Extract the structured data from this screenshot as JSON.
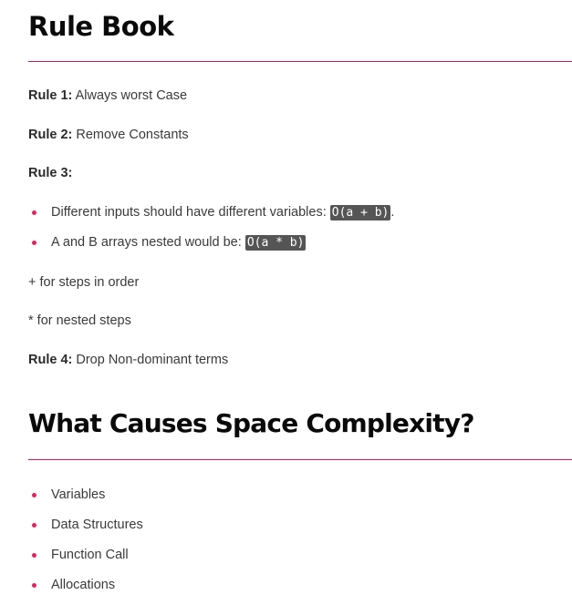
{
  "rule_book": {
    "title": "Rule Book",
    "rule1": {
      "label": "Rule 1:",
      "text": "Always worst Case"
    },
    "rule2": {
      "label": "Rule 2:",
      "text": "Remove Constants"
    },
    "rule3": {
      "label": "Rule 3:",
      "bullets": [
        {
          "text": "Different inputs should have different variables: ",
          "code": "O(a + b)",
          "suffix": "."
        },
        {
          "text": "A and B arrays nested would be: ",
          "code": "O(a * b)",
          "suffix": ""
        }
      ],
      "note_plus": "+ for steps in order",
      "note_star": "* for nested steps"
    },
    "rule4": {
      "label": "Rule 4:",
      "text": "Drop Non-dominant terms"
    }
  },
  "space_complexity": {
    "title": "What Causes Space Complexity?",
    "items": [
      "Variables",
      "Data Structures",
      "Function Call",
      "Allocations"
    ]
  },
  "colors": {
    "accent": "#e0245e",
    "divider": "#c2185b",
    "code_bg": "#555555"
  }
}
